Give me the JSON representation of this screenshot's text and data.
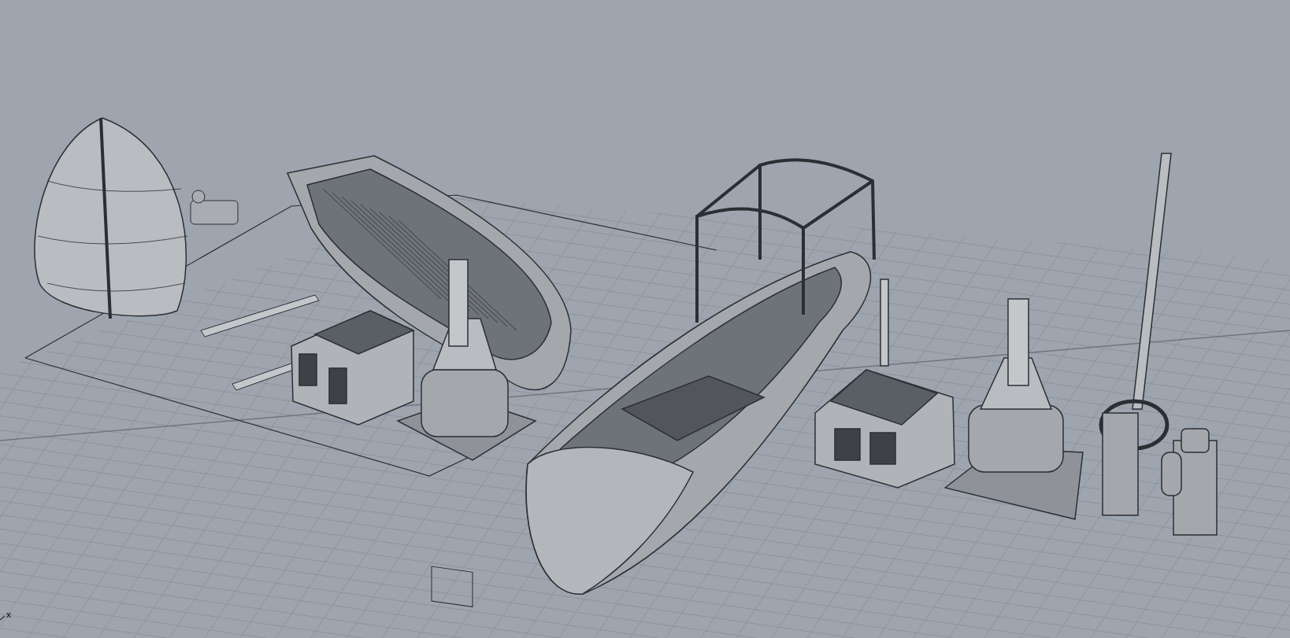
{
  "viewport": {
    "axis_labels": [
      "x"
    ]
  }
}
